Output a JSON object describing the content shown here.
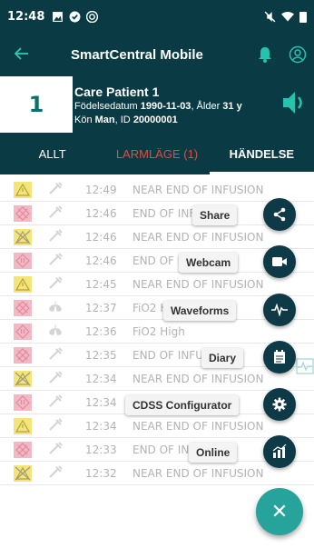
{
  "status": {
    "time": "12:48"
  },
  "appbar": {
    "title": "SmartCentral Mobile"
  },
  "patient": {
    "bed": "1",
    "name": "Care Patient 1",
    "dob_label": "Födelsedatum ",
    "dob": "1990-11-03",
    "age_label": ", Ålder ",
    "age": "31 y",
    "sex_label": "Kön ",
    "sex": "Man",
    "id_label": ", ID ",
    "id": "20000001"
  },
  "tabs": [
    {
      "label": "ALLT"
    },
    {
      "label": "LARMLÄGE (1)"
    },
    {
      "label": "HÄNDELSE"
    }
  ],
  "events": [
    {
      "time": "12:49",
      "message": "NEAR END OF INFUSION",
      "kind": "warning",
      "source": "syringe"
    },
    {
      "time": "12:46",
      "message": "END OF INFUSION",
      "kind": "alarm",
      "source": "syringe"
    },
    {
      "time": "12:46",
      "message": "NEAR END OF INFUSION",
      "kind": "muted",
      "source": "syringe"
    },
    {
      "time": "12:46",
      "message": "END OF INFUSION",
      "kind": "alarm-high",
      "source": "syringe"
    },
    {
      "time": "12:45",
      "message": "NEAR END OF INFUSION",
      "kind": "warning",
      "source": "syringe"
    },
    {
      "time": "12:37",
      "message": "FiO2 High",
      "kind": "alarm",
      "source": "lungs"
    },
    {
      "time": "12:36",
      "message": "FiO2 High",
      "kind": "alarm-high",
      "source": "lungs"
    },
    {
      "time": "12:35",
      "message": "END OF INFUSION",
      "kind": "alarm",
      "source": "syringe"
    },
    {
      "time": "12:34",
      "message": "NEAR END OF INFUSION",
      "kind": "muted",
      "source": "syringe"
    },
    {
      "time": "12:34",
      "message": "END OF INFUSION",
      "kind": "alarm-high",
      "source": "syringe"
    },
    {
      "time": "12:34",
      "message": "NEAR END OF INFUSION",
      "kind": "warning",
      "source": "syringe"
    },
    {
      "time": "12:33",
      "message": "END OF INFUSION",
      "kind": "alarm",
      "source": "syringe"
    },
    {
      "time": "12:32",
      "message": "NEAR END OF INFUSION",
      "kind": "muted",
      "source": "syringe"
    }
  ],
  "fab_menu": [
    {
      "label": "Share",
      "icon": "share-icon"
    },
    {
      "label": "Webcam",
      "icon": "video-camera-icon"
    },
    {
      "label": "Waveforms",
      "icon": "waveform-icon"
    },
    {
      "label": "Diary",
      "icon": "diary-icon"
    },
    {
      "label": "CDSS Configurator",
      "icon": "gear-icon"
    },
    {
      "label": "Online",
      "icon": "bar-chart-icon"
    }
  ],
  "fab_main": {
    "icon": "close-icon",
    "symbol": "✕"
  },
  "colors": {
    "header_bg": "#0a3a44",
    "accent": "#26a39a",
    "alarm_red": "#e34a4a",
    "warning_yellow": "#f3e57a",
    "alarm_pink": "#f2b8c4"
  }
}
